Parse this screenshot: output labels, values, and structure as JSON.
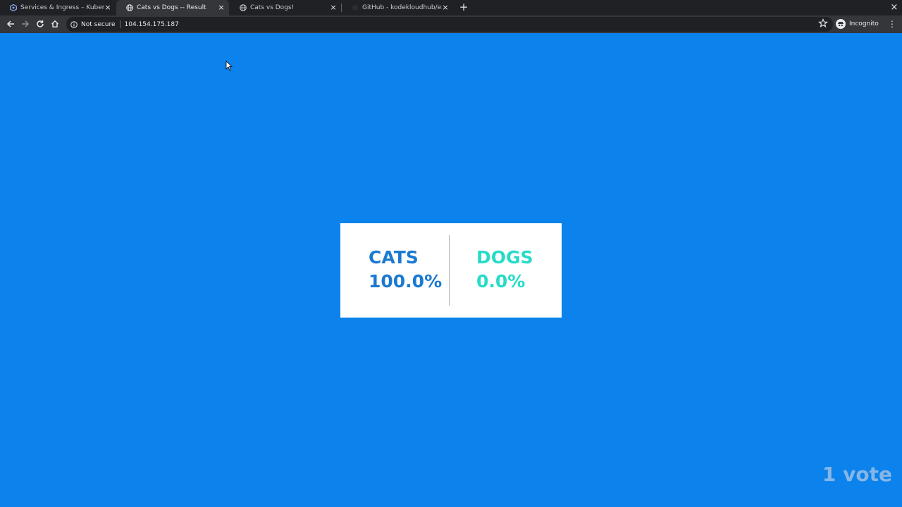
{
  "browser": {
    "tabs": [
      {
        "title": "Services & Ingress – Kubernetes",
        "active": false
      },
      {
        "title": "Cats vs Dogs -- Result",
        "active": true
      },
      {
        "title": "Cats vs Dogs!",
        "active": false
      },
      {
        "title": "GitHub - kodekloudhub/example",
        "active": false
      }
    ],
    "security_label": "Not secure",
    "url": "104.154.175.187",
    "profile_label": "Incognito"
  },
  "result": {
    "cats_label": "CATS",
    "cats_percent": "100.0%",
    "dogs_label": "DOGS",
    "dogs_percent": "0.0%",
    "votes_text": "1 vote"
  },
  "colors": {
    "background": "#0b82ec",
    "cats": "#1b79d0",
    "dogs": "#27dbc8"
  }
}
